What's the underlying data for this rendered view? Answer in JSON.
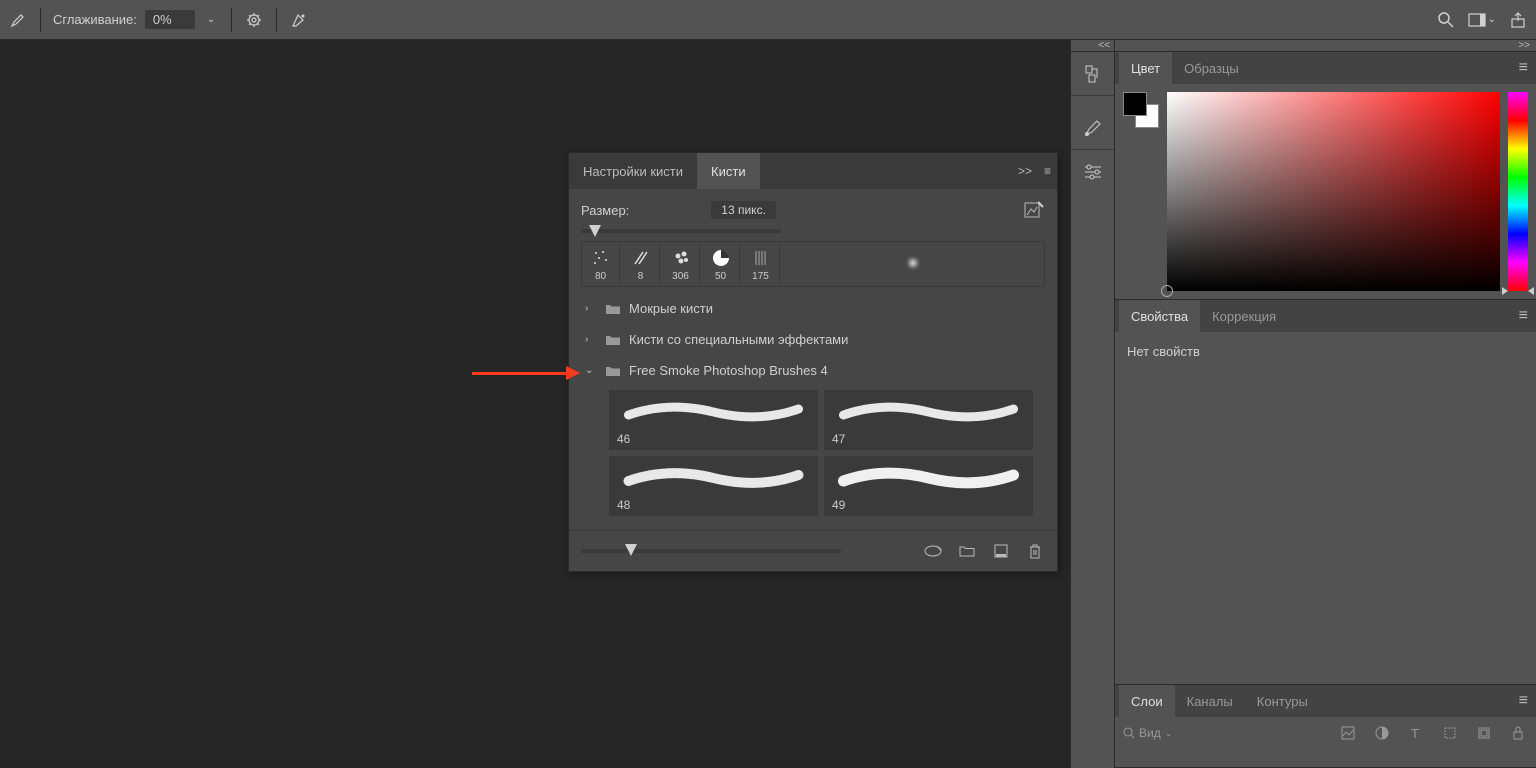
{
  "topbar": {
    "smoothing_label": "Сглаживание:",
    "smoothing_value": "0%"
  },
  "brushes_panel": {
    "tab_settings": "Настройки кисти",
    "tab_brushes": "Кисти",
    "size_label": "Размер:",
    "size_value": "13 пикс.",
    "tips": [
      {
        "size": "80"
      },
      {
        "size": "8"
      },
      {
        "size": "306"
      },
      {
        "size": "50"
      },
      {
        "size": "175"
      },
      {
        "size": ""
      }
    ],
    "folders": [
      {
        "name": "Мокрые кисти",
        "expanded": false
      },
      {
        "name": "Кисти со специальными эффектами",
        "expanded": false
      },
      {
        "name": "Free Smoke Photoshop Brushes 4",
        "expanded": true
      }
    ],
    "brushes": [
      {
        "label": "46"
      },
      {
        "label": "47"
      },
      {
        "label": "48"
      },
      {
        "label": "49"
      }
    ]
  },
  "color_panel": {
    "tab_color": "Цвет",
    "tab_swatches": "Образцы"
  },
  "properties_panel": {
    "tab_properties": "Свойства",
    "tab_adjustments": "Коррекция",
    "empty_text": "Нет свойств"
  },
  "layers_panel": {
    "tab_layers": "Слои",
    "tab_channels": "Каналы",
    "tab_paths": "Контуры",
    "filter_label": "Вид"
  }
}
